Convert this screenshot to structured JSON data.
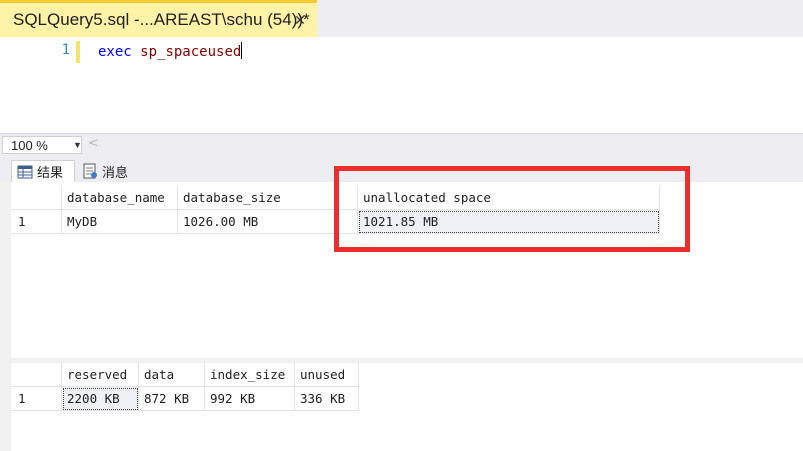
{
  "document_tab": {
    "title": "SQLQuery5.sql -...AREAST\\schu (54))*",
    "close": "✕"
  },
  "editor": {
    "line_number": "1",
    "code_keyword": "exec",
    "code_procedure": "sp_spaceused"
  },
  "zoom": {
    "value": "100 %",
    "arrow": "▼",
    "scroll_left": "<"
  },
  "result_tabs": {
    "results_label": "结果",
    "messages_label": "消息"
  },
  "grid1": {
    "headers": [
      "database_name",
      "database_size",
      "unallocated space"
    ],
    "row_number": "1",
    "row": [
      "MyDB",
      "1026.00 MB",
      "1021.85 MB"
    ]
  },
  "grid2": {
    "headers": [
      "reserved",
      "data",
      "index_size",
      "unused"
    ],
    "row_number": "1",
    "row": [
      "2200 KB",
      "872 KB",
      "992 KB",
      "336 KB"
    ]
  },
  "colors": {
    "tab_active": "#fff3a8",
    "tab_accent": "#f5cc2b",
    "keyword": "#0000ff",
    "procedure": "#800000",
    "line_number": "#2b91af",
    "highlight": "#ee2d2d"
  }
}
